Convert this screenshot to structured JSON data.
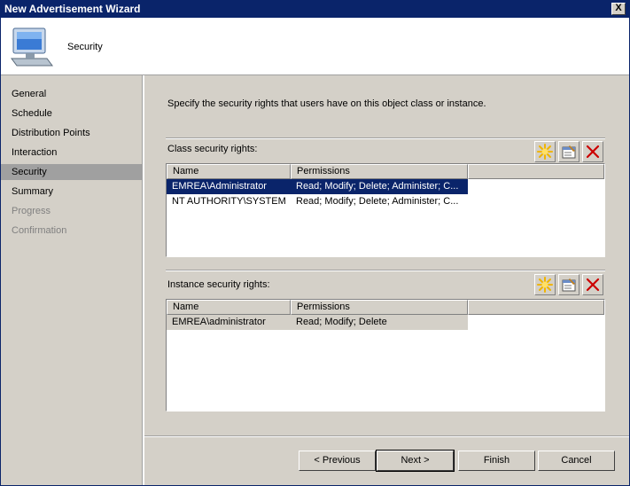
{
  "window": {
    "title": "New Advertisement Wizard",
    "close_glyph": "X"
  },
  "header": {
    "title": "Security",
    "icon": "computer-icon"
  },
  "nav": {
    "items": [
      {
        "label": "General",
        "state": "normal"
      },
      {
        "label": "Schedule",
        "state": "normal"
      },
      {
        "label": "Distribution Points",
        "state": "normal"
      },
      {
        "label": "Interaction",
        "state": "normal"
      },
      {
        "label": "Security",
        "state": "selected"
      },
      {
        "label": "Summary",
        "state": "normal"
      },
      {
        "label": "Progress",
        "state": "disabled"
      },
      {
        "label": "Confirmation",
        "state": "disabled"
      }
    ]
  },
  "content": {
    "intro": "Specify the security rights that users have on this object class or instance.",
    "class_rights": {
      "label": "Class security rights:",
      "columns": [
        "Name",
        "Permissions"
      ],
      "rows": [
        {
          "name": "EMREA\\Administrator",
          "permissions": "Read; Modify; Delete; Administer; C..."
        },
        {
          "name": "NT AUTHORITY\\SYSTEM",
          "permissions": "Read; Modify; Delete; Administer; C..."
        }
      ]
    },
    "instance_rights": {
      "label": "Instance security rights:",
      "columns": [
        "Name",
        "Permissions"
      ],
      "rows": [
        {
          "name": "EMREA\\administrator",
          "permissions": "Read; Modify; Delete"
        }
      ]
    }
  },
  "buttons": {
    "previous": "< Previous",
    "next": "Next >",
    "finish": "Finish",
    "cancel": "Cancel"
  },
  "colors": {
    "title_bar": "#0a246a",
    "selection": "#0a246a",
    "delete_red": "#cc0000",
    "new_star": "#ffcc00"
  }
}
